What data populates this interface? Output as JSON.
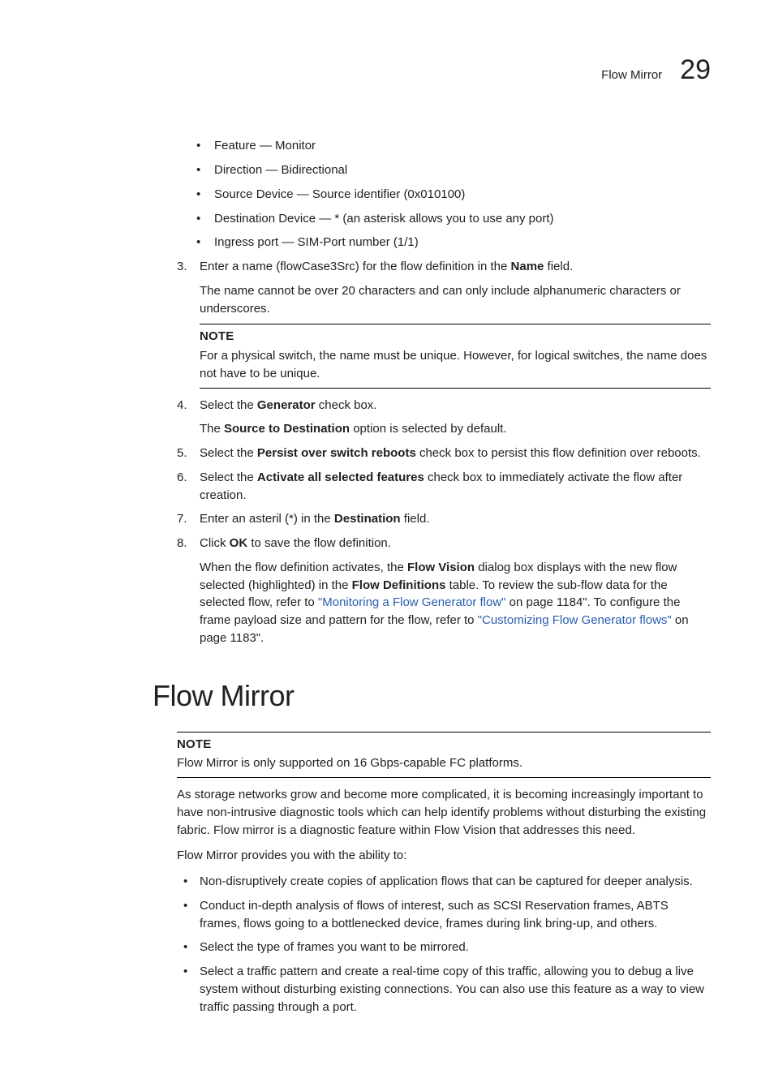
{
  "header": {
    "title": "Flow Mirror",
    "chapter": "29"
  },
  "bullets": [
    "Feature — Monitor",
    "Direction — Bidirectional",
    "Source Device — Source identifier (0x010100)",
    "Destination Device — * (an asterisk allows you to use any port)",
    "Ingress port — SIM-Port number (1/1)"
  ],
  "step3": {
    "num": "3.",
    "t1": "Enter a name (flowCase3Src) for the flow definition in the ",
    "b1": "Name",
    "t2": " field.",
    "p2": "The name cannot be over 20 characters and can only include alphanumeric characters or underscores.",
    "noteLabel": "NOTE",
    "noteBody": "For a physical switch, the name must be unique. However, for logical switches, the name does not have to be unique."
  },
  "step4": {
    "num": "4.",
    "t1": "Select the ",
    "b1": "Generator",
    "t2": " check box.",
    "p2a": "The ",
    "p2b": "Source to Destination",
    "p2c": " option is selected by default."
  },
  "step5": {
    "num": "5.",
    "t1": "Select the ",
    "b1": "Persist over switch reboots",
    "t2": " check box to persist this flow definition over reboots."
  },
  "step6": {
    "num": "6.",
    "t1": "Select the ",
    "b1": "Activate all selected features",
    "t2": " check box to immediately activate the flow after creation."
  },
  "step7": {
    "num": "7.",
    "t1": "Enter an asteril (*) in the ",
    "b1": "Destination",
    "t2": " field."
  },
  "step8": {
    "num": "8.",
    "t1": "Click ",
    "b1": "OK",
    "t2": " to save the flow definition.",
    "p2a": "When the flow definition activates, the ",
    "p2b": "Flow Vision",
    "p2c": " dialog box displays with the new flow selected (highlighted) in the ",
    "p2d": "Flow Definitions",
    "p2e": " table. To review the sub-flow data for the selected flow, refer to ",
    "link1": "\"Monitoring a Flow Generator flow\"",
    "p2f": " on page 1184\". To configure the frame payload size and pattern for the flow, refer to ",
    "link2": "\"Customizing Flow Generator flows\"",
    "p2g": " on page 1183\"."
  },
  "mirror": {
    "heading": "Flow Mirror",
    "noteLabel": "NOTE",
    "noteBody": "Flow Mirror is only supported on 16 Gbps-capable FC platforms.",
    "intro": "As storage networks grow and become more complicated, it is becoming increasingly important to have non-intrusive diagnostic tools which can help identify problems without disturbing the existing fabric. Flow mirror is a diagnostic feature within Flow Vision that addresses this need.",
    "lead": "Flow Mirror provides you with the ability to:",
    "items": [
      "Non-disruptively create copies of application flows that can be captured for deeper analysis.",
      "Conduct in-depth analysis of flows of interest, such as SCSI Reservation frames, ABTS frames, flows going to a bottlenecked device, frames during link bring-up, and others.",
      "Select the type of frames you want to be mirrored.",
      "Select a traffic pattern and create a real-time copy of this traffic, allowing you to debug a live system without disturbing existing connections. You can also use this feature as a way to view traffic passing through a port."
    ]
  }
}
